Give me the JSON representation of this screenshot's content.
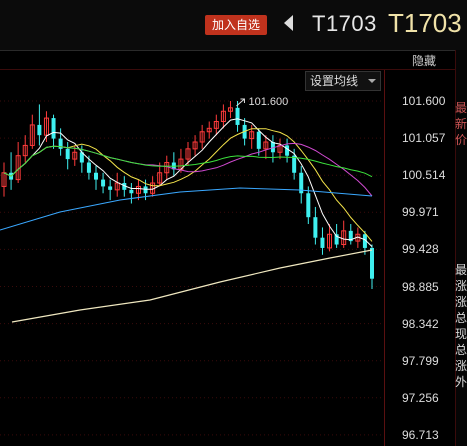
{
  "toolbar": {
    "add_watchlist_label": "加入自选",
    "contract_code": "T1703",
    "contract_code_large": "T1703",
    "hide_label": "隐藏",
    "set_ma_label": "设置均线"
  },
  "chart": {
    "price_ticks": [
      "101.600",
      "101.057",
      "100.514",
      "99.971",
      "99.428",
      "98.885",
      "98.342",
      "97.799",
      "97.256",
      "96.713"
    ],
    "high_marker": "101.600",
    "colors": {
      "up_candle": "#ff3b3b",
      "down_candle": "#3ff0f0",
      "axis": "#5a1010",
      "grid": "#3a0b0b"
    },
    "moving_average_colors": [
      "#ffffff",
      "#f2e24a",
      "#d04ad0",
      "#3ce23c",
      "#3aa8ff",
      "#f0e8c0"
    ]
  },
  "right_panel": {
    "upper_text": "最新价",
    "lower_text": "最 涨 涨 总 现 总 涨 外"
  }
}
